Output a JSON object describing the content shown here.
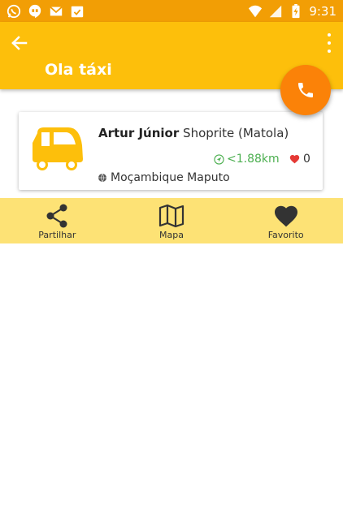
{
  "status_bar": {
    "time": "9:31",
    "icons_left": [
      "whatsapp-icon",
      "hangouts-icon",
      "gmail-icon",
      "calendar-icon"
    ],
    "icons_right": [
      "wifi-icon",
      "signal-icon",
      "battery-charging-icon"
    ]
  },
  "app_bar": {
    "title": "Ola táxi",
    "back_icon": "arrow-left-icon",
    "menu_icon": "more-vertical-icon"
  },
  "fab": {
    "icon": "phone-icon",
    "color": "#fb8208"
  },
  "card": {
    "driver_name": "Artur Júnior",
    "place": "Shoprite (Matola)",
    "distance": "<1.88km",
    "likes": "0",
    "location": "Moçambique Maputo",
    "image_icon": "taxi-icon"
  },
  "actions": [
    {
      "label": "Partilhar",
      "icon": "share-icon"
    },
    {
      "label": "Mapa",
      "icon": "map-icon"
    },
    {
      "label": "Favorito",
      "icon": "heart-icon"
    }
  ],
  "colors": {
    "status_bar": "#f29e05",
    "app_bar": "#fdbf0b",
    "action_bar": "#fde275",
    "accent": "#fb8208",
    "distance": "#4caf50",
    "heart": "#e53935"
  }
}
